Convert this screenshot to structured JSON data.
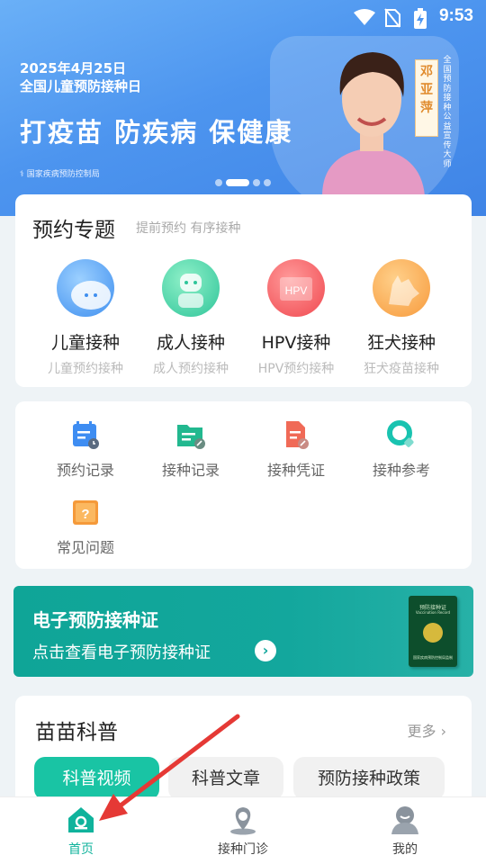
{
  "status_bar": {
    "time": "9:53"
  },
  "banner": {
    "date_line1": "2025年4月25日",
    "date_line2": "全国儿童预防接种日",
    "slogan": "打疫苗 防疾病 保健康",
    "org": "国家疾病预防控制局",
    "name": "邓亚萍",
    "ambassador": "全国预防接种公益宣传大师",
    "slide_count": 4,
    "active_slide": 2
  },
  "topics": {
    "title": "预约专题",
    "subtitle": "提前预约 有序接种",
    "items": [
      {
        "label": "儿童接种",
        "sub": "儿童预约接种",
        "icon": "child-icon",
        "color": "#3f8fef"
      },
      {
        "label": "成人接种",
        "sub": "成人预约接种",
        "icon": "adult-icon",
        "color": "#2fc59a"
      },
      {
        "label": "HPV接种",
        "sub": "HPV预约接种",
        "icon": "hpv-icon",
        "icon_text": "HPV",
        "color": "#f0484f"
      },
      {
        "label": "狂犬接种",
        "sub": "狂犬疫苗接种",
        "icon": "dog-icon",
        "color": "#f79a3c"
      }
    ]
  },
  "records": {
    "items": [
      {
        "label": "预约记录",
        "icon": "calendar-clock-icon",
        "color": "#3e8df2"
      },
      {
        "label": "接种记录",
        "icon": "folder-record-icon",
        "color": "#22b88f"
      },
      {
        "label": "接种凭证",
        "icon": "certificate-doc-icon",
        "color": "#f06a57"
      },
      {
        "label": "接种参考",
        "icon": "search-reference-icon",
        "color": "#19c3b0"
      },
      {
        "label": "常见问题",
        "icon": "faq-icon",
        "color": "#f59a3a",
        "icon_text": "?"
      }
    ]
  },
  "certificate": {
    "title": "电子预防接种证",
    "subtitle": "点击查看电子预防接种证",
    "go_glyph": "›",
    "booklet_title": "预防接种证",
    "booklet_sub": "Vaccination Record",
    "booklet_footer": "国家疾病预防控制局监制"
  },
  "science": {
    "title": "苗苗科普",
    "more": "更多 ›",
    "tabs": [
      {
        "label": "科普视频",
        "active": true
      },
      {
        "label": "科普文章",
        "active": false
      },
      {
        "label": "预防接种政策",
        "active": false
      }
    ]
  },
  "nav": {
    "items": [
      {
        "label": "首页",
        "icon": "home-icon",
        "active": true
      },
      {
        "label": "接种门诊",
        "icon": "location-pin-icon",
        "active": false
      },
      {
        "label": "我的",
        "icon": "profile-icon",
        "active": false
      }
    ]
  },
  "colors": {
    "brand": "#10b39c",
    "annotation": "#e53935"
  }
}
